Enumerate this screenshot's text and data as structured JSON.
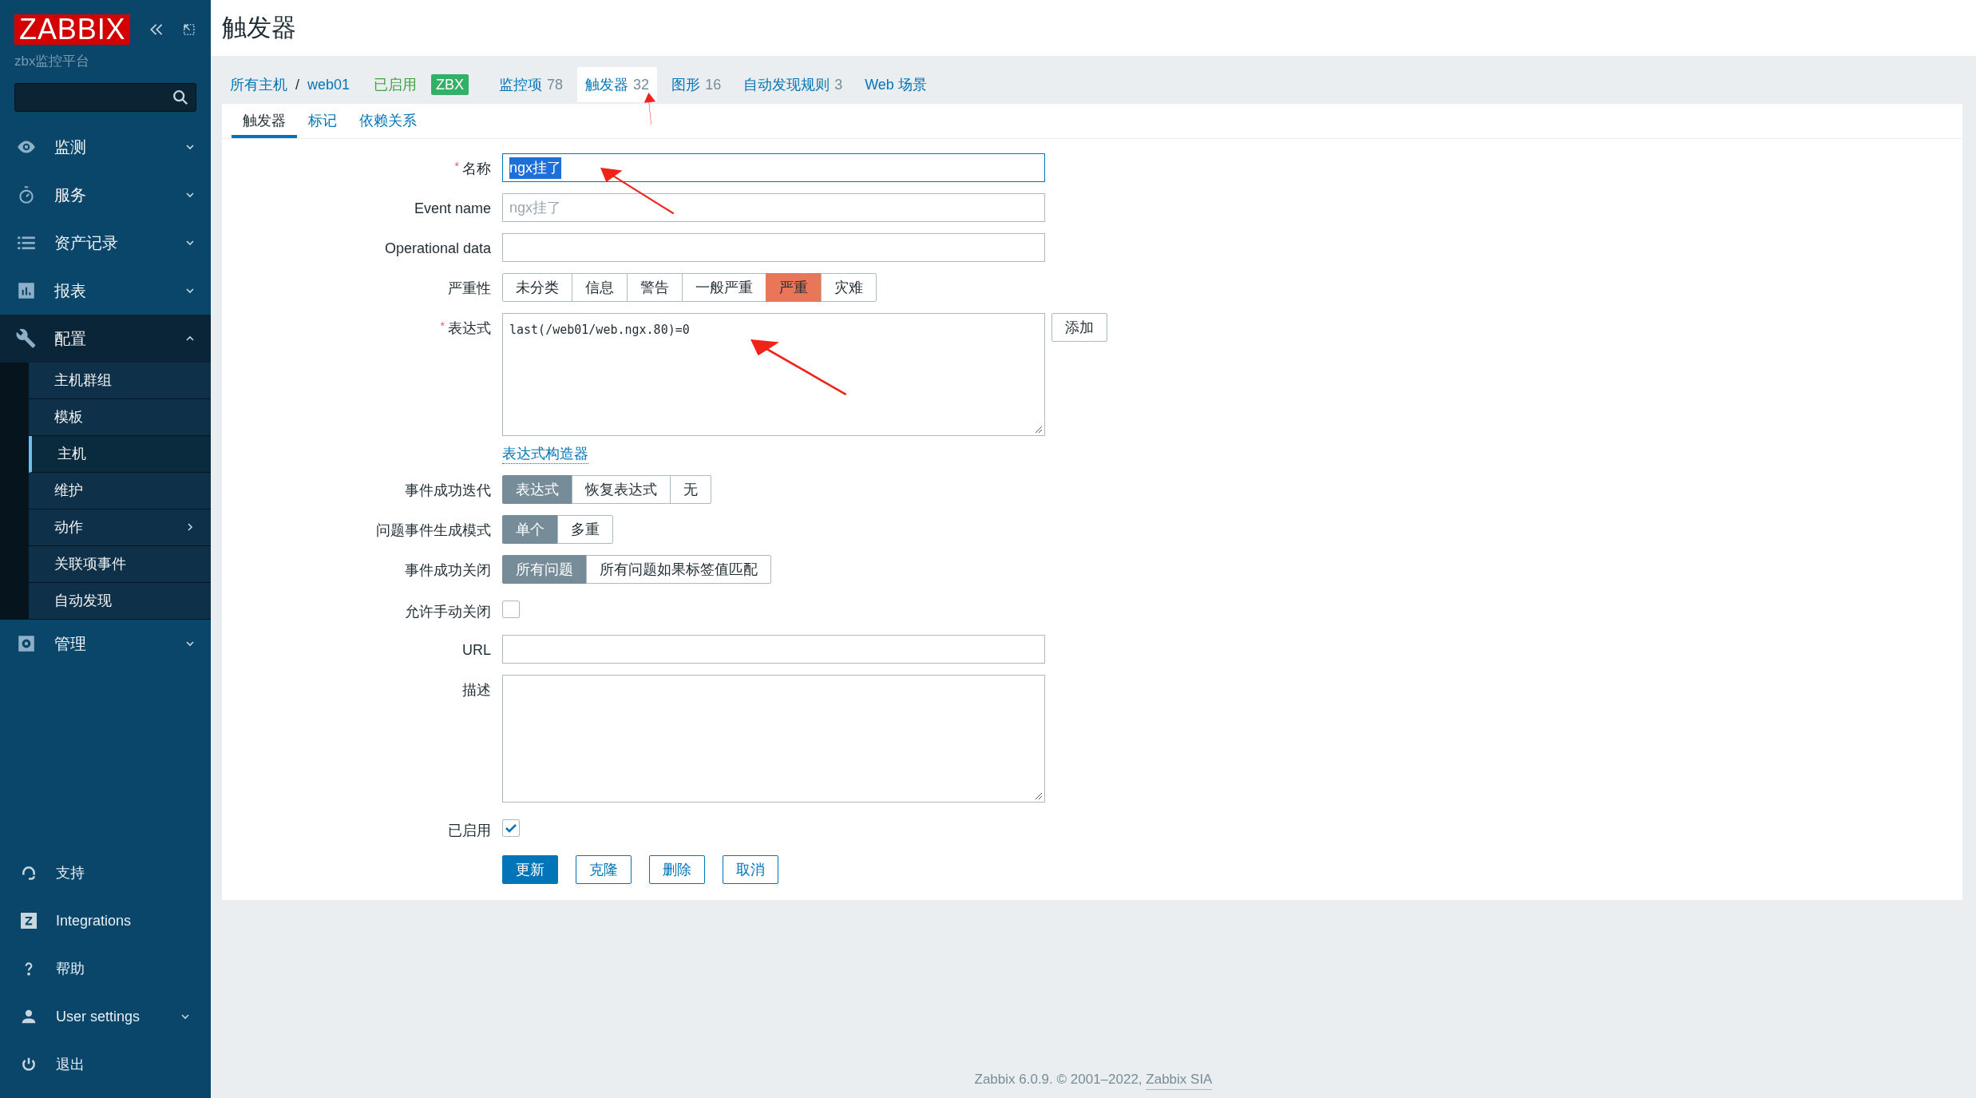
{
  "sidebar": {
    "logo": "ZABBIX",
    "subtitle": "zbx监控平台",
    "menu": [
      {
        "label": "监测",
        "expanded": false
      },
      {
        "label": "服务",
        "expanded": false
      },
      {
        "label": "资产记录",
        "expanded": false
      },
      {
        "label": "报表",
        "expanded": false
      },
      {
        "label": "配置",
        "expanded": true,
        "children": [
          {
            "label": "主机群组",
            "selected": false,
            "submenu": false
          },
          {
            "label": "模板",
            "selected": false,
            "submenu": false
          },
          {
            "label": "主机",
            "selected": true,
            "submenu": false
          },
          {
            "label": "维护",
            "selected": false,
            "submenu": false
          },
          {
            "label": "动作",
            "selected": false,
            "submenu": true
          },
          {
            "label": "关联项事件",
            "selected": false,
            "submenu": false
          },
          {
            "label": "自动发现",
            "selected": false,
            "submenu": false
          }
        ]
      },
      {
        "label": "管理",
        "expanded": false
      }
    ],
    "bottom": [
      {
        "label": "支持",
        "expandable": false
      },
      {
        "label": "Integrations",
        "expandable": false
      },
      {
        "label": "帮助",
        "expandable": false
      },
      {
        "label": "User settings",
        "expandable": true
      },
      {
        "label": "退出",
        "expandable": false
      }
    ]
  },
  "page_title": "触发器",
  "host_nav": {
    "breadcrumb": [
      {
        "label": "所有主机"
      },
      {
        "label": "web01"
      }
    ],
    "separator": "/",
    "status": "已启用",
    "badge": "ZBX",
    "tabs": [
      {
        "label": "监控项",
        "count": "78",
        "selected": false
      },
      {
        "label": "触发器",
        "count": "32",
        "selected": true
      },
      {
        "label": "图形",
        "count": "16",
        "selected": false
      },
      {
        "label": "自动发现规则",
        "count": "3",
        "selected": false
      },
      {
        "label": "Web 场景",
        "selected": false
      }
    ]
  },
  "form_tabs": [
    {
      "label": "触发器",
      "selected": true
    },
    {
      "label": "标记",
      "selected": false
    },
    {
      "label": "依赖关系",
      "selected": false
    }
  ],
  "fields": [
    {
      "kind": "text",
      "label": "名称",
      "required_mark": "*",
      "value": "ngx挂了",
      "highlighted": true
    },
    {
      "kind": "text",
      "label": "Event name",
      "placeholder": "ngx挂了"
    },
    {
      "kind": "text",
      "label": "Operational data"
    },
    {
      "kind": "segmented",
      "label": "严重性",
      "color": "#e97659",
      "options": [
        {
          "label": "未分类",
          "selected": false
        },
        {
          "label": "信息",
          "selected": false
        },
        {
          "label": "警告",
          "selected": false
        },
        {
          "label": "一般严重",
          "selected": false
        },
        {
          "label": "严重",
          "selected": true
        },
        {
          "label": "灾难",
          "selected": false
        }
      ]
    },
    {
      "kind": "expression",
      "label": "表达式",
      "required_mark": "*",
      "value": "last(/web01/web.ngx.80)=0",
      "button": "添加",
      "link": "表达式构造器"
    },
    {
      "kind": "segmented",
      "label": "事件成功迭代",
      "color": "#768d99",
      "options": [
        {
          "label": "表达式",
          "selected": true
        },
        {
          "label": "恢复表达式",
          "selected": false
        },
        {
          "label": "无",
          "selected": false
        }
      ]
    },
    {
      "kind": "segmented",
      "label": "问题事件生成模式",
      "color": "#768d99",
      "options": [
        {
          "label": "单个",
          "selected": true
        },
        {
          "label": "多重",
          "selected": false
        }
      ]
    },
    {
      "kind": "segmented",
      "label": "事件成功关闭",
      "color": "#768d99",
      "options": [
        {
          "label": "所有问题",
          "selected": true
        },
        {
          "label": "所有问题如果标签值匹配",
          "selected": false
        }
      ]
    },
    {
      "kind": "checkbox",
      "label": "允许手动关闭",
      "checked": false
    },
    {
      "kind": "text",
      "label": "URL"
    },
    {
      "kind": "textarea",
      "label": "描述"
    },
    {
      "kind": "checkbox",
      "label": "已启用",
      "checked": true
    }
  ],
  "buttons": [
    {
      "label": "更新",
      "primary": true
    },
    {
      "label": "克隆",
      "primary": false
    },
    {
      "label": "删除",
      "primary": false
    },
    {
      "label": "取消",
      "primary": false
    }
  ],
  "footer": {
    "text": "Zabbix 6.0.9. © 2001–2022, ",
    "link": "Zabbix SIA"
  }
}
